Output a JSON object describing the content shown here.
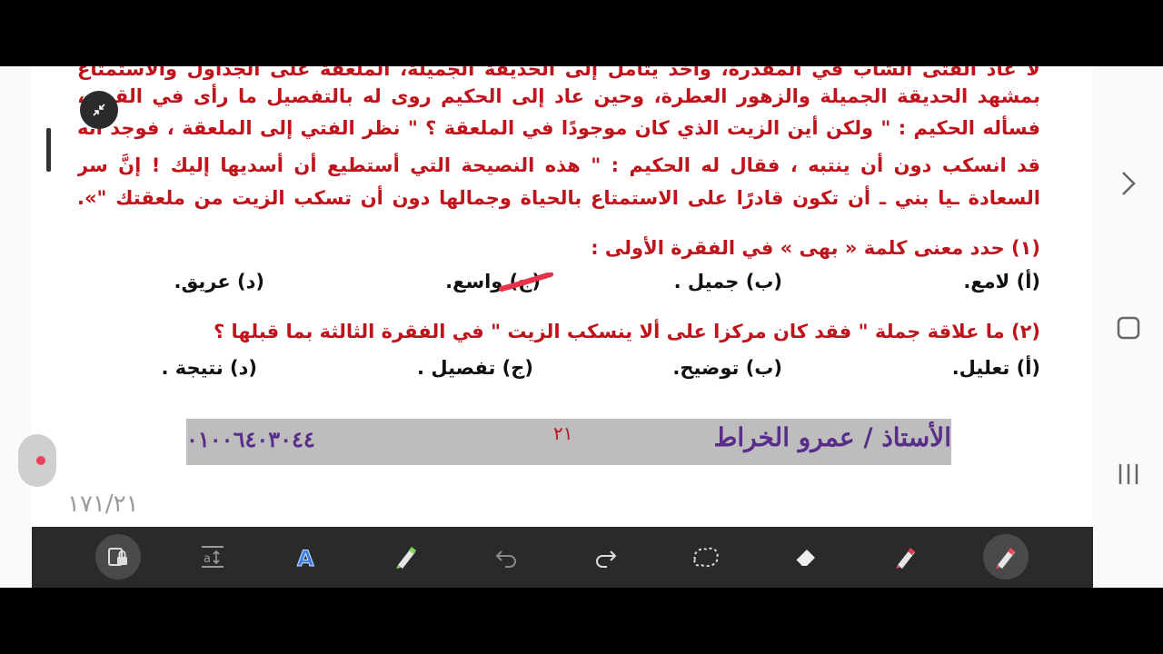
{
  "paragraph_lines": [
    "لا عاد الفتى الشاب في المقدرة، وأخذ يتأمل إلى الحديقة الجميلة، الملعقة على الجداول والاستمتاع",
    "بمشهد الحديقة الجميلة والزهور العطرة، وحين عاد إلى الحكيم روى له بالتفصيل ما رأى في القصر،",
    "فسأله الحكيم : \" ولكن أين الزيت الذي كان موجودًا في الملعقة ؟ \" نظر الفتي إلى الملعقة ، فوجد أنه",
    "قد انسكب دون أن ينتبه ، فقال له الحكيم : \" هذه النصيحة التي أستطيع أن أسديها إليك ! إنَّ سر",
    "السعادة ـيا بني ـ أن تكون قادرًا على الاستمتاع بالحياة وجمالها دون أن تسكب الزيت من ملعقتك \"»."
  ],
  "question1": {
    "text": "(١) حدد معنى كلمة « بهى » في الفقرة الأولى :",
    "options": [
      "(أ) لامع.",
      "(ب) جميل .",
      "(ج) واسع.",
      "(د) عريق."
    ]
  },
  "question2": {
    "text": "(٢) ما علاقة جملة \" فقد كان مركزا على ألا ينسكب الزيت  \" في الفقرة الثالثة بما قبلها ؟",
    "options": [
      "(أ) تعليل.",
      "(ب) توضيح.",
      "(ج) تفصيل .",
      "(د) نتيجة ."
    ]
  },
  "footer": {
    "teacher": "الأستاذ / عمرو الخراط",
    "page_number": "٢١",
    "phone": "٠١٠٠٦٤٠٣٠٤٤"
  },
  "page_indicator": "١٧١/٢١",
  "toolbar": {
    "tools": [
      "lock-tool",
      "text-size-tool",
      "text-tool",
      "highlighter-tool",
      "undo",
      "redo",
      "lasso-tool",
      "eraser-tool",
      "pen-tool",
      "active-pen-tool"
    ]
  },
  "colors": {
    "text_red": "#c0141c",
    "footer_purple": "#5a2d8c",
    "toolbar_bg": "#2a2a2a"
  }
}
